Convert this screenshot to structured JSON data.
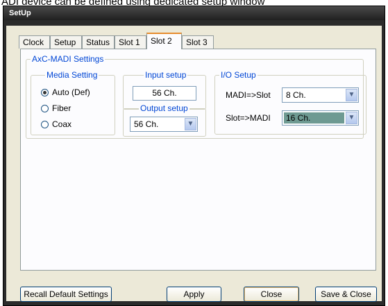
{
  "caption": "ADI device can be defined using dedicated setup window",
  "window": {
    "title": "SetUp"
  },
  "tabs": [
    {
      "label": "Clock",
      "active": false
    },
    {
      "label": "Setup",
      "active": false
    },
    {
      "label": "Status",
      "active": false
    },
    {
      "label": "Slot 1",
      "active": false
    },
    {
      "label": "Slot 2",
      "active": true
    },
    {
      "label": "Slot 3",
      "active": false
    }
  ],
  "axc_madi": {
    "title": "AxC-MADI Settings",
    "media": {
      "title": "Media Setting",
      "options": [
        "Auto (Def)",
        "Fiber",
        "Coax"
      ],
      "selected": "Auto (Def)"
    },
    "input": {
      "title": "Input setup",
      "value": "56 Ch."
    },
    "output": {
      "title": "Output setup",
      "value": "56 Ch."
    },
    "io": {
      "title": "I/O Setup",
      "madi_to_slot_label": "MADI=>Slot",
      "madi_to_slot_value": "8 Ch.",
      "slot_to_madi_label": "Slot=>MADI",
      "slot_to_madi_value": "16 Ch."
    }
  },
  "buttons": {
    "recall": "Recall Default Settings",
    "apply": "Apply",
    "close": "Close",
    "save_close": "Save & Close"
  },
  "colors": {
    "titlebar": "#2b2b2b",
    "accent": "#0046d5",
    "highlight": "#6e9a92",
    "active_tab": "#e68b2c"
  }
}
